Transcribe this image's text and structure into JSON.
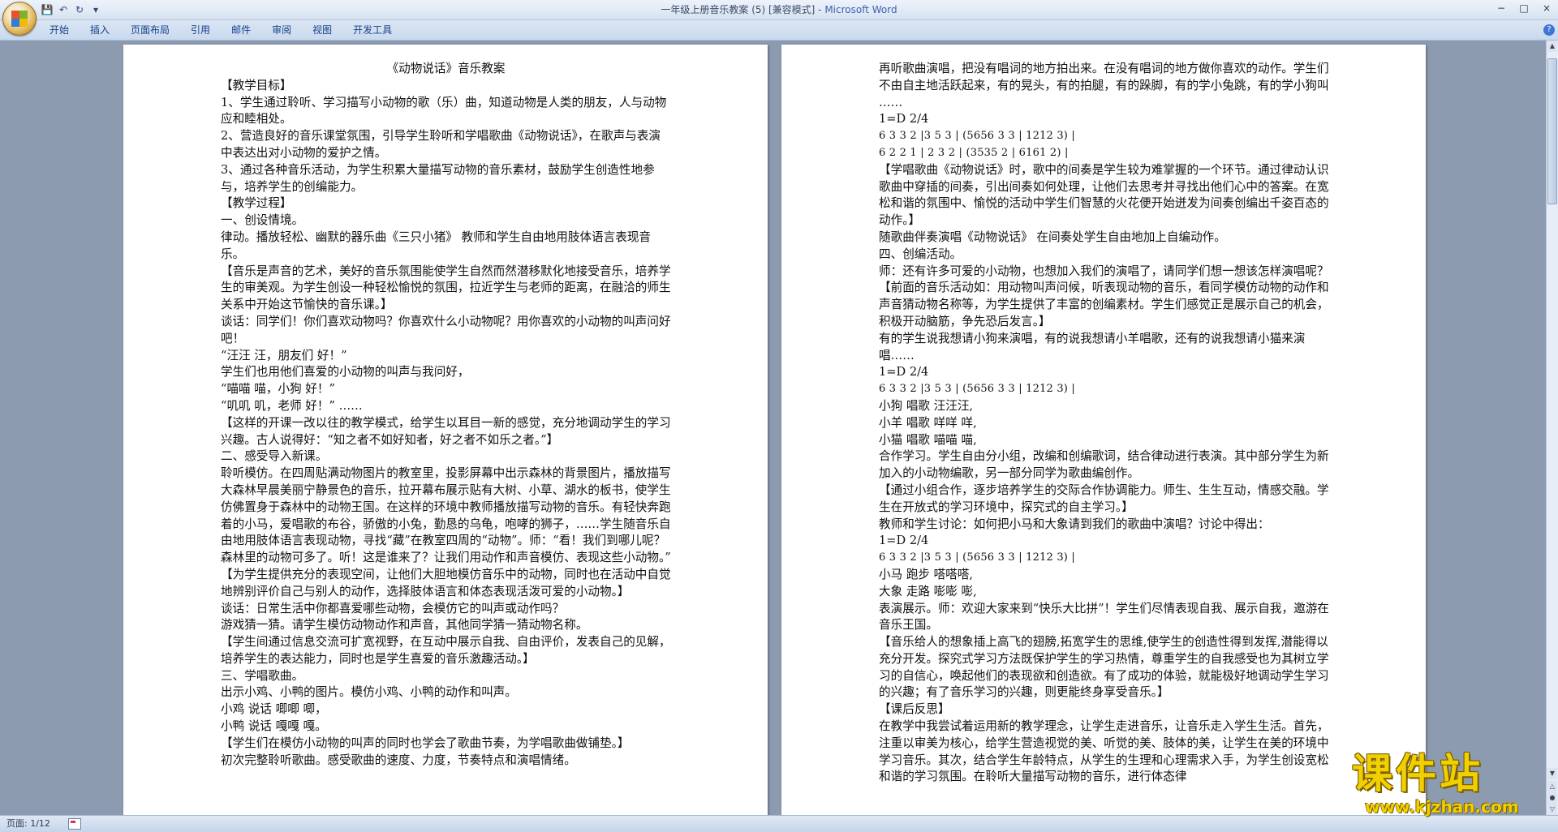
{
  "window": {
    "title": "一年级上册音乐教案 (5) [兼容模式] - ",
    "app_name": "Microsoft Word",
    "controls": [
      "−",
      "□",
      "×"
    ]
  },
  "quick_access": [
    "save",
    "undo",
    "redo",
    "customize"
  ],
  "ribbon": {
    "tabs": [
      "开始",
      "插入",
      "页面布局",
      "引用",
      "邮件",
      "审阅",
      "视图",
      "开发工具"
    ],
    "help_label": "?"
  },
  "document": {
    "left_page": [
      {
        "text": "《动物说话》音乐教案",
        "style": "center"
      },
      {
        "text": "【教学目标】"
      },
      {
        "text": "1、学生通过聆听、学习描写小动物的歌（乐）曲，知道动物是人类的朋友，人与动物应和睦相处。"
      },
      {
        "text": "2、营造良好的音乐课堂氛围，引导学生聆听和学唱歌曲《动物说话》，在歌声与表演中表达出对小动物的爱护之情。"
      },
      {
        "text": "3、通过各种音乐活动，为学生积累大量描写动物的音乐素材，鼓励学生创造性地参与，培养学生的创编能力。"
      },
      {
        "text": "【教学过程】"
      },
      {
        "text": "一、创设情境。"
      },
      {
        "text": "律动。播放轻松、幽默的器乐曲《三只小猪》 教师和学生自由地用肢体语言表现音乐。"
      },
      {
        "text": "【音乐是声音的艺术，美好的音乐氛围能使学生自然而然潜移默化地接受音乐，培养学生的审美观。为学生创设一种轻松愉悦的氛围，拉近学生与老师的距离，在融洽的师生关系中开始这节愉快的音乐课。】"
      },
      {
        "text": "谈话：同学们！你们喜欢动物吗？你喜欢什么小动物呢？用你喜欢的小动物的叫声问好吧！"
      },
      {
        "text": "“汪汪 汪，朋友们 好！”"
      },
      {
        "text": "学生们也用他们喜爱的小动物的叫声与我问好，"
      },
      {
        "text": "“喵喵 喵，小狗 好！”"
      },
      {
        "text": "“叽叽 叽，老师 好！” ……"
      },
      {
        "text": "【这样的开课一改以往的教学模式，给学生以耳目一新的感觉，充分地调动学生的学习兴趣。古人说得好：“知之者不如好知者，好之者不如乐之者。”】"
      },
      {
        "text": "二、感受导入新课。"
      },
      {
        "text": "聆听模仿。在四周贴满动物图片的教室里，投影屏幕中出示森林的背景图片，播放描写大森林早晨美丽宁静景色的音乐，拉开幕布展示贴有大树、小草、湖水的板书，使学生仿佛置身于森林中的动物王国。在这样的环境中教师播放描写动物的音乐。有轻快奔跑着的小马，爱唱歌的布谷，骄傲的小兔，勤恳的乌龟，咆哮的狮子，……学生随音乐自由地用肢体语言表现动物，寻找“藏”在教室四周的“动物”。师：“看！我们到哪儿呢？森林里的动物可多了。听！这是谁来了？让我们用动作和声音模仿、表现这些小动物。”"
      },
      {
        "text": "【为学生提供充分的表现空间，让他们大胆地模仿音乐中的动物，同时也在活动中自觉地辨别评价自己与别人的动作，选择肢体语言和体态表现活泼可爱的小动物。】"
      },
      {
        "text": "谈话：日常生活中你都喜爱哪些动物，会模仿它的叫声或动作吗？"
      },
      {
        "text": "游戏猜一猜。请学生模仿动物动作和声音，其他同学猜一猜动物名称。"
      },
      {
        "text": "【学生间通过信息交流可扩宽视野，在互动中展示自我、自由评价，发表自己的见解，培养学生的表达能力，同时也是学生喜爱的音乐激趣活动。】"
      },
      {
        "text": "三、学唱歌曲。"
      },
      {
        "text": "出示小鸡、小鸭的图片。模仿小鸡、小鸭的动作和叫声。"
      },
      {
        "text": "小鸡 说话 唧唧 唧，"
      },
      {
        "text": "小鸭 说话 嘎嘎 嘎。"
      },
      {
        "text": "【学生们在模仿小动物的叫声的同时也学会了歌曲节奏，为学唱歌曲做铺垫。】"
      },
      {
        "text": "初次完整聆听歌曲。感受歌曲的速度、力度，节奏特点和演唱情绪。"
      }
    ],
    "right_page": [
      {
        "text": "再听歌曲演唱，把没有唱词的地方拍出来。在没有唱词的地方做你喜欢的动作。学生们不由自主地活跃起来，有的晃头，有的拍腿，有的跺脚，有的学小兔跳，有的学小狗叫 ……"
      },
      {
        "text": "1=D 2/4"
      },
      {
        "text": "6 3 3 2 |3 5 3 | (5656 3 3 | 1212 3) |",
        "style": "notation"
      },
      {
        "text": "6 2 2 1 | 2 3 2 | (3535 2 | 6161 2) |",
        "style": "notation"
      },
      {
        "text": "【学唱歌曲《动物说话》时，歌中的间奏是学生较为难掌握的一个环节。通过律动认识歌曲中穿插的间奏，引出间奏如何处理，让他们去思考并寻找出他们心中的答案。在宽松和谐的氛围中、愉悦的活动中学生们智慧的火花便开始迸发为间奏创编出千姿百态的动作。】"
      },
      {
        "text": "随歌曲伴奏演唱《动物说话》 在间奏处学生自由地加上自编动作。"
      },
      {
        "text": "四、创编活动。"
      },
      {
        "text": "师：还有许多可爱的小动物，也想加入我们的演唱了，请同学们想一想该怎样演唱呢？"
      },
      {
        "text": "【前面的音乐活动如：用动物叫声问候，听表现动物的音乐，看同学模仿动物的动作和声音猜动物名称等，为学生提供了丰富的创编素材。学生们感觉正是展示自己的机会，积极开动脑筋，争先恐后发言。】"
      },
      {
        "text": "有的学生说我想请小狗来演唱，有的说我想请小羊唱歌，还有的说我想请小猫来演唱……"
      },
      {
        "text": "1=D 2/4"
      },
      {
        "text": "6 3 3 2 |3 5 3 | (5656 3 3 | 1212 3) |",
        "style": "notation"
      },
      {
        "text": "小狗 唱歌 汪汪汪,"
      },
      {
        "text": "小羊 唱歌 咩咩 咩,"
      },
      {
        "text": "小猫 唱歌 喵喵 喵,"
      },
      {
        "text": "合作学习。学生自由分小组，改编和创编歌词，结合律动进行表演。其中部分学生为新加入的小动物编歌，另一部分同学为歌曲编创作。"
      },
      {
        "text": "【通过小组合作，逐步培养学生的交际合作协调能力。师生、生生互动，情感交融。学生在开放式的学习环境中，探究式的自主学习。】"
      },
      {
        "text": "教师和学生讨论：如何把小马和大象请到我们的歌曲中演唱？讨论中得出："
      },
      {
        "text": "1=D 2/4"
      },
      {
        "text": "6 3 3 2 |3 5 3 | (5656 3 3 | 1212 3) |",
        "style": "notation"
      },
      {
        "text": "小马 跑步 嗒嗒嗒,"
      },
      {
        "text": "大象 走路 嘭嘭 嘭,"
      },
      {
        "text": "表演展示。师：欢迎大家来到“快乐大比拼”！学生们尽情表现自我、展示自我，邀游在音乐王国。"
      },
      {
        "text": "【音乐给人的想象插上高飞的翅膀,拓宽学生的思维,使学生的创造性得到发挥,潜能得以充分开发。探究式学习方法既保护学生的学习热情，尊重学生的自我感受也为其树立学习的自信心，唤起他们的表现欲和创造欲。有了成功的体验，就能极好地调动学生学习的兴趣；有了音乐学习的兴趣，则更能终身享受音乐。】"
      },
      {
        "text": "【课后反思】"
      },
      {
        "text": "在教学中我尝试着运用新的教学理念，让学生走进音乐，让音乐走入学生生活。首先，注重以审美为核心，给学生营造视觉的美、听觉的美、肢体的美，让学生在美的环境中学习音乐。其次，结合学生年龄特点，从学生的生理和心理需求入手，为学生创设宽松和谐的学习氛围。在聆听大量描写动物的音乐，进行体态律"
      }
    ]
  },
  "status": {
    "page_label": "页面: 1/12"
  },
  "watermark": {
    "title": "课件站",
    "url": "www.kjzhan.com"
  }
}
